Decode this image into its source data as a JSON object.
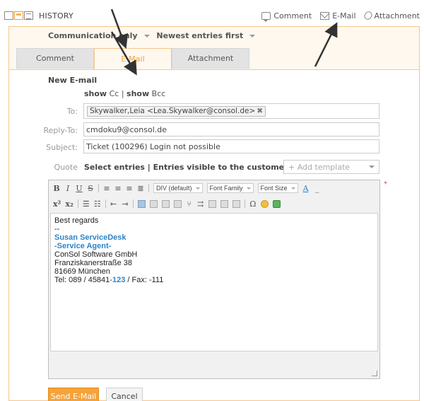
{
  "header": {
    "title": "HISTORY",
    "actions": {
      "comment": "Comment",
      "email": "E-Mail",
      "attachment": "Attachment"
    }
  },
  "filter": {
    "communication": "Communication only",
    "order": "Newest entries first"
  },
  "tabs": [
    {
      "label": "Comment",
      "active": false
    },
    {
      "label": "E-Mail",
      "active": true
    },
    {
      "label": "Attachment",
      "active": false
    }
  ],
  "form": {
    "section_title": "New E-mail",
    "show_cc_strong": "show",
    "show_cc": "Cc",
    "show_bcc_strong": "show",
    "show_bcc": "Bcc",
    "to_label": "To:",
    "to_chip": "Skywalker,Leia <Lea.Skywalker@consol.de>",
    "reply_to_label": "Reply-To:",
    "reply_to_value": "cmdoku9@consol.de",
    "subject_label": "Subject:",
    "subject_value": "Ticket (100296) Login not possible",
    "quote_label": "Quote",
    "quote_links": "Select entries | Entries visible to the customer",
    "template_placeholder": "+ Add template"
  },
  "editor": {
    "format_dropdown": "DIV (default)",
    "font_family": "Font Family",
    "font_size": "Font Size",
    "body": {
      "greeting": "Best regards",
      "dashes": "--",
      "name": "Susan ServiceDesk",
      "role": "-Service Agent-",
      "company": "ConSol Software GmbH",
      "street": "Franziskanerstraße 38",
      "city": "81669 München",
      "tel_prefix": "Tel: 089 / 45841-",
      "tel_ext": "123",
      "fax": " / Fax: -111"
    }
  },
  "buttons": {
    "send": "Send E-Mail",
    "cancel": "Cancel"
  },
  "colors": {
    "accent": "#f5a33a",
    "panel_border": "#f7c58a",
    "link_blue": "#2e84c6"
  }
}
